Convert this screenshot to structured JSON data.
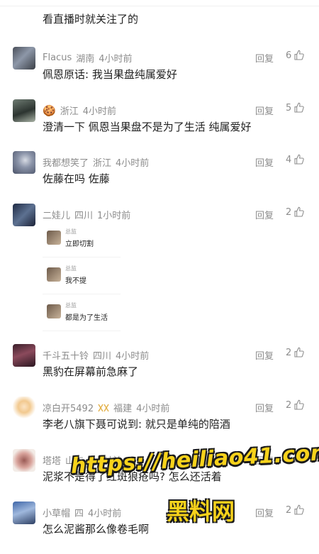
{
  "top_text": "看直播时就关注了的",
  "reply_label": "回复",
  "colors": {
    "meta": "#8c8c8c",
    "text": "#1f1f1f",
    "watermark": "#f7d21b"
  },
  "comments": [
    {
      "user": "Flacus",
      "region": "湖南",
      "time": "4小时前",
      "likes": "6",
      "text": "佩恩原话: 我当果盘纯属爱好",
      "avatar": "avatar-photo"
    },
    {
      "emoji": "🍪",
      "region": "浙江",
      "time": "4小时前",
      "likes": "5",
      "text": "澄清一下 佩恩当果盘不是为了生活 纯属爱好",
      "avatar": "avatar-photo"
    },
    {
      "user": "我都想笑了",
      "region": "浙江",
      "time": "4小时前",
      "likes": "4",
      "text": "佐藤在吗 佐藤",
      "avatar": "avatar-photo"
    },
    {
      "user": "二娃儿",
      "region": "四川",
      "time": "1小时前",
      "likes": "2",
      "text": "",
      "avatar": "avatar-photo",
      "cards": [
        {
          "title": "总监",
          "body": "立即切割"
        },
        {
          "title": "总监",
          "body": "我不提"
        },
        {
          "title": "总监",
          "body": "都是为了生活"
        }
      ]
    },
    {
      "user": "千斗五十铃",
      "region": "四川",
      "time": "4小时前",
      "likes": "2",
      "text": "黑豹在屏幕前急麻了",
      "avatar": "avatar-photo"
    },
    {
      "user": "凉白开5492",
      "region": "福建",
      "time": "4小时前",
      "likes": "2",
      "text": "李老八旗下聂可说到: 就只是单纯的陪酒",
      "avatar": "avatar-photo",
      "badge": "ribbon-icon"
    },
    {
      "user": "塔塔",
      "region": "山东",
      "time": "4小时前",
      "likes": "2",
      "text": "泥浆不是得了红斑狼疮吗? 怎么还活着",
      "avatar": "avatar-photo"
    },
    {
      "user": "小草帽",
      "region": "四",
      "time": "4小时前",
      "likes": "2",
      "text": "怎么泥酱那么像卷毛啊",
      "avatar": "avatar-photo"
    }
  ],
  "watermark": {
    "url": "https://heiliao41.com",
    "name": "黑料网"
  }
}
